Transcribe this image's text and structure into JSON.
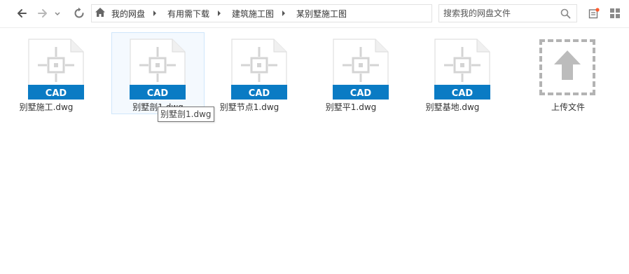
{
  "nav": {
    "back_icon": "arrow-left-icon",
    "forward_icon": "arrow-right-icon",
    "history_icon": "chevron-down-icon",
    "refresh_icon": "refresh-icon"
  },
  "breadcrumb": {
    "home_icon": "home-icon",
    "items": [
      "我的网盘",
      "有用需下载",
      "建筑施工图",
      "某别墅施工图"
    ]
  },
  "search": {
    "placeholder": "搜索我的网盘文件",
    "value": ""
  },
  "toolbar_right": {
    "notification_icon": "notification-icon",
    "badge_color": "#ff5a2c",
    "view_icon": "grid-view-icon"
  },
  "files": [
    {
      "name": "别墅施工.dwg",
      "badge": "CAD",
      "icon": "cad-file-icon"
    },
    {
      "name": "别墅剖1.dwg",
      "badge": "CAD",
      "icon": "cad-file-icon",
      "selected": true
    },
    {
      "name": "别墅节点1.dwg",
      "badge": "CAD",
      "icon": "cad-file-icon"
    },
    {
      "name": "别墅平1.dwg",
      "badge": "CAD",
      "icon": "cad-file-icon"
    },
    {
      "name": "别墅基地.dwg",
      "badge": "CAD",
      "icon": "cad-file-icon"
    }
  ],
  "upload": {
    "label": "上传文件",
    "icon": "upload-arrow-icon"
  },
  "tooltip": {
    "text": "别墅剖1.dwg"
  },
  "colors": {
    "cad_band": "#0a7bc4",
    "selection_bg": "#f4f9fe",
    "selection_border": "#cfe6fb",
    "icon_gray": "#d4d4d4"
  }
}
